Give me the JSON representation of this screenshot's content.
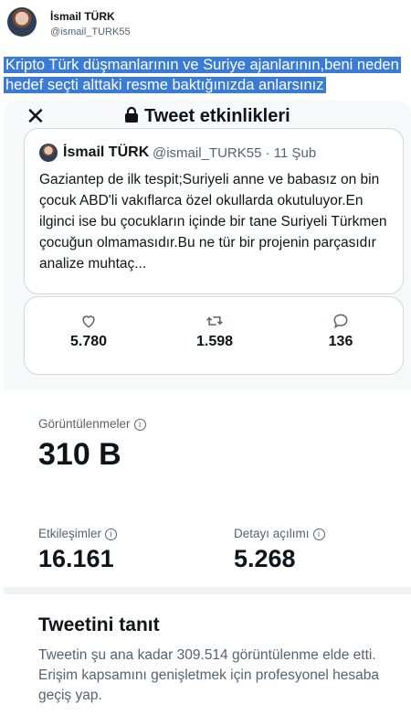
{
  "tweet": {
    "author_name": "İsmail TÜRK",
    "author_handle": "@ismail_TURK55",
    "text": "Kripto Türk düşmanlarının ve Suriye ajanlarının,beni neden hedef seçti alttaki resme baktığınızda anlarsınız"
  },
  "modal": {
    "title": "Tweet etkinlikleri",
    "quoted": {
      "author_name": "İsmail TÜRK",
      "handle_date": "@ismail_TURK55 · 11 Şub",
      "text": "Gaziantep de ilk tespit;Suriyeli anne ve babasız on bin çocuk ABD'li vakıflarca özel okullarda okutuluyor.En ilginci ise bu çocukların içinde bir tane Suriyeli Türkmen çocuğun olmamasıdır.Bu ne tür bir projenin parçasıdır analize muhtaç..."
    },
    "stats": {
      "likes": "5.780",
      "retweets": "1.598",
      "replies": "136"
    },
    "impressions_label": "Görüntülenmeler",
    "impressions_value": "310 B",
    "engagements_label": "Etkileşimler",
    "engagements_value": "16.161",
    "detail_label": "Detayı açılımı",
    "detail_value": "5.268",
    "promote_title": "Tweetini tanıt",
    "promote_text": "Tweetin şu ana kadar 309.514 görüntülenme elde etti. Erişim kapsamını genişletmek için profesyonel hesaba geçiş yap."
  },
  "icons": {
    "close": "close-icon",
    "lock": "lock-icon",
    "like": "heart-icon",
    "retweet": "retweet-icon",
    "reply": "reply-icon",
    "info": "info-icon"
  },
  "colors": {
    "highlight": "#3a7bd5",
    "secondary_text": "#536471"
  }
}
